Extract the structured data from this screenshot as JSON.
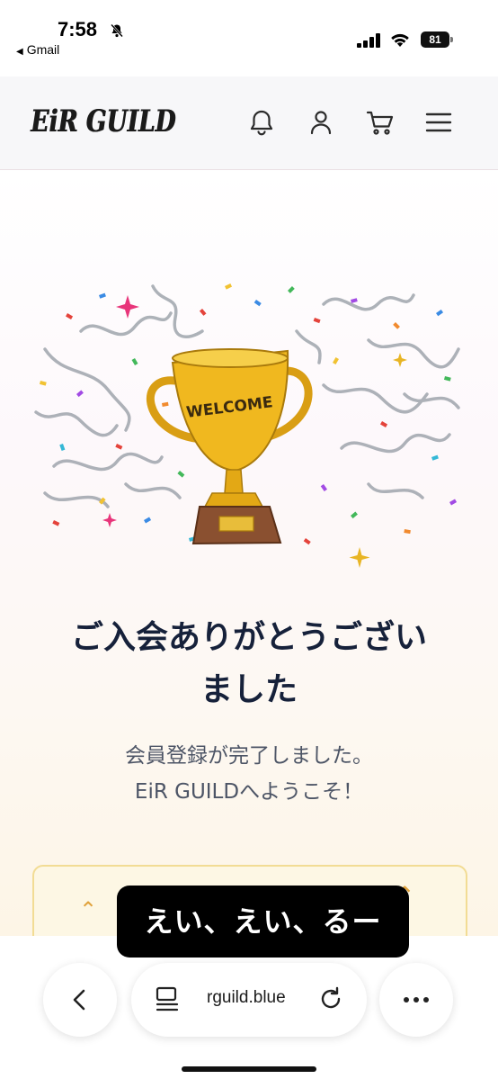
{
  "status_bar": {
    "time": "7:58",
    "back_app": "Gmail",
    "battery": "81",
    "icons": [
      "bell-slash-icon",
      "cellular-signal-icon",
      "wifi-icon",
      "battery-icon"
    ]
  },
  "header": {
    "logo": "EiR GUILD",
    "icons": [
      "bell-icon",
      "user-icon",
      "cart-icon",
      "menu-icon"
    ]
  },
  "illustration": {
    "trophy_text": "WELCOME"
  },
  "main": {
    "headline_line1": "ご入会ありがとうござい",
    "headline_line2": "ました",
    "sub_line1": "会員登録が完了しました。",
    "sub_line2": "EiR GUILDへようこそ！"
  },
  "overlay": {
    "caption": "えい、えい、るー"
  },
  "browser": {
    "url": "rguild.blue",
    "icons": [
      "back-icon",
      "tabs-icon",
      "reload-icon",
      "more-icon"
    ]
  },
  "colors": {
    "headline": "#16213a",
    "subtext": "#4d5566",
    "card_border": "#f2dc94",
    "card_bg": "#fdf7e4",
    "trophy_gold": "#f0b81f"
  }
}
